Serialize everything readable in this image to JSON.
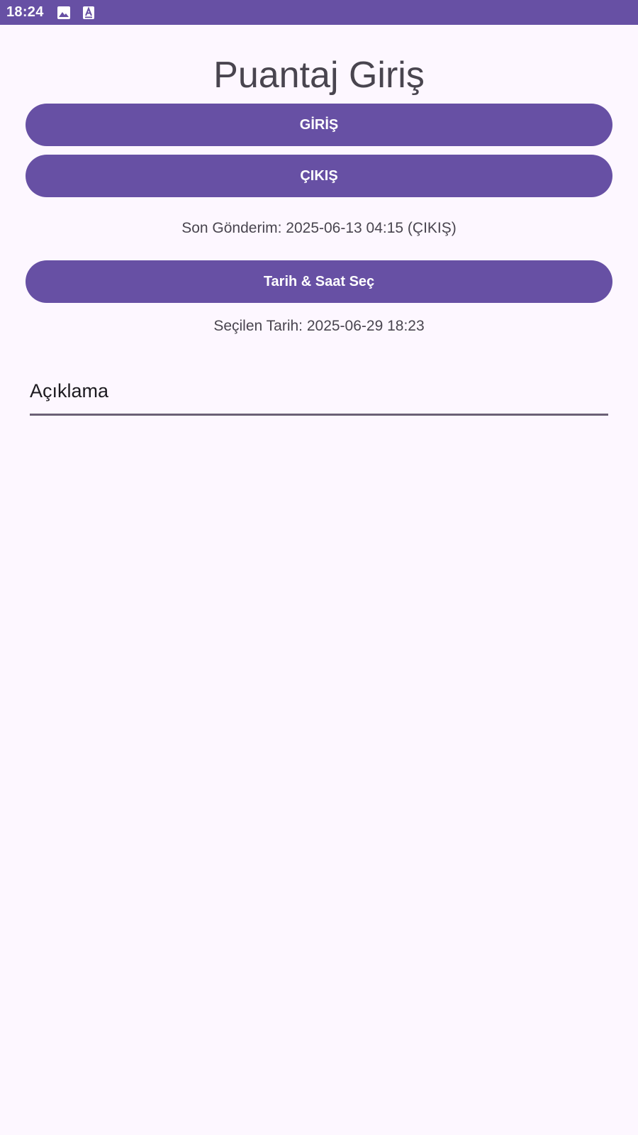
{
  "status_bar": {
    "time": "18:24",
    "icons": [
      "image-icon",
      "text-a-icon"
    ],
    "color": "#6750a4"
  },
  "title": "Puantaj Giriş",
  "buttons": {
    "giris": "GİRİŞ",
    "cikis": "ÇIKIŞ",
    "tarih_saat": "Tarih & Saat Seç"
  },
  "last_sent": "Son Gönderim: 2025-06-13 04:15 (ÇIKIŞ)",
  "selected_date": "Seçilen Tarih: 2025-06-29 18:23",
  "description_field": {
    "placeholder": "Açıklama",
    "value": ""
  },
  "colors": {
    "accent": "#6750a4",
    "background": "#fdf7ff",
    "text": "#49454f"
  }
}
